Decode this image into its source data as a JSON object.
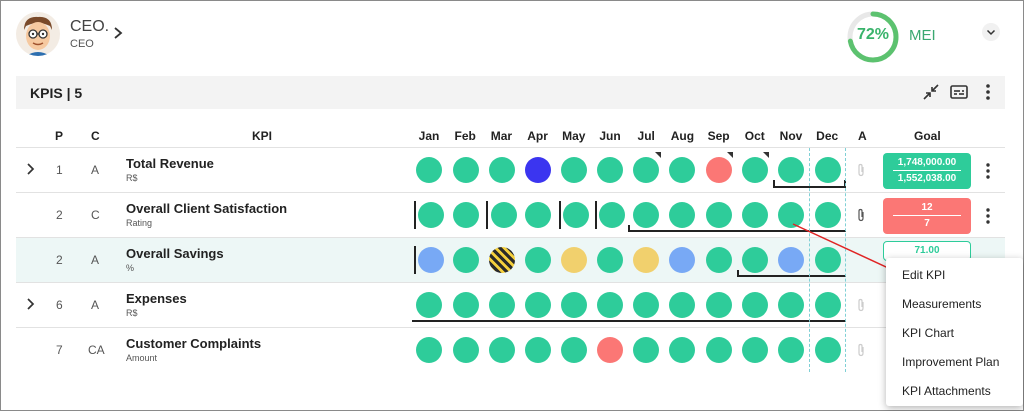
{
  "header": {
    "user_name": "CEO.",
    "user_role": "CEO",
    "gauge": {
      "percent_label": "72%",
      "value": 0.72,
      "label": "MEI"
    }
  },
  "toolbar": {
    "title": "KPIS | 5"
  },
  "table": {
    "headers": {
      "p": "P",
      "c": "C",
      "kpi": "KPI",
      "a": "A",
      "goal": "Goal"
    },
    "months": [
      "Jan",
      "Feb",
      "Mar",
      "Apr",
      "May",
      "Jun",
      "Jul",
      "Aug",
      "Sep",
      "Oct",
      "Nov",
      "Dec"
    ],
    "rows": [
      {
        "p": "1",
        "c": "A",
        "name": "Total Revenue",
        "unit": "R$",
        "goal_top": "1,748,000.00",
        "goal_bottom": "1,552,038.00"
      },
      {
        "p": "2",
        "c": "C",
        "name": "Overall Client Satisfaction",
        "unit": "Rating",
        "goal_top": "12",
        "goal_bottom": "7"
      },
      {
        "p": "2",
        "c": "A",
        "name": "Overall Savings",
        "unit": "%",
        "goal_top": "71.00"
      },
      {
        "p": "6",
        "c": "A",
        "name": "Expenses",
        "unit": "R$"
      },
      {
        "p": "7",
        "c": "CA",
        "name": "Customer Complaints",
        "unit": "Amount"
      }
    ]
  },
  "context_menu": {
    "items": [
      "Edit KPI",
      "Measurements",
      "KPI Chart",
      "Improvement Plan",
      "KPI Attachments"
    ]
  },
  "colors": {
    "green": "#2ecc9a",
    "red": "#fb7775",
    "blue": "#3b35f0",
    "light_blue": "#78a9f5",
    "yellow": "#f1d06d",
    "accent": "#39b36b"
  }
}
